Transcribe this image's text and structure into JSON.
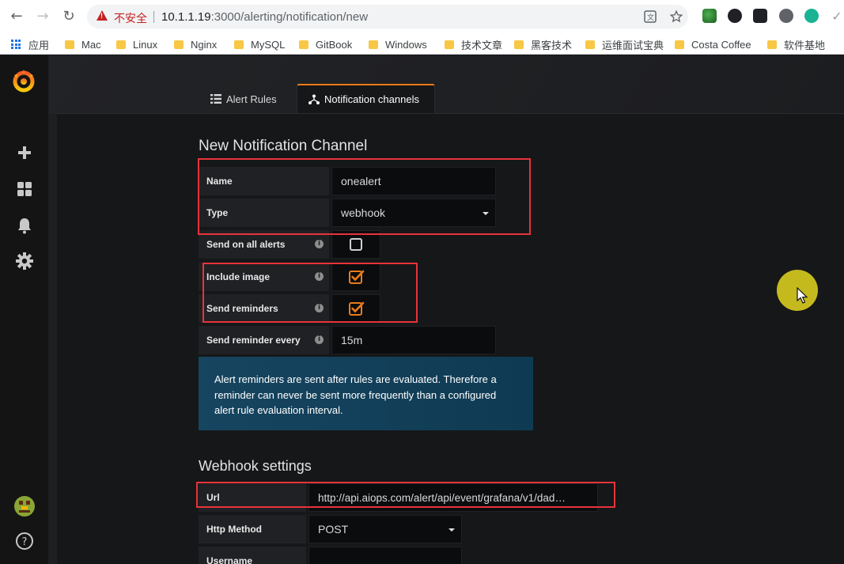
{
  "browser": {
    "security_label": "不安全",
    "url_host": "10.1.1.19",
    "url_path": ":3000/alerting/notification/new",
    "bookmarks": [
      "应用",
      "Mac",
      "Linux",
      "Nginx",
      "MySQL",
      "GitBook",
      "Windows",
      "技术文章",
      "黑客技术",
      "运维面试宝典",
      "Costa Coffee",
      "软件基地"
    ]
  },
  "tabs": {
    "alert_rules": "Alert Rules",
    "notification_channels": "Notification channels"
  },
  "form": {
    "title": "New Notification Channel",
    "name_label": "Name",
    "name_value": "onealert",
    "type_label": "Type",
    "type_value": "webhook",
    "send_all_label": "Send on all alerts",
    "send_all_checked": false,
    "include_image_label": "Include image",
    "include_image_checked": true,
    "send_reminders_label": "Send reminders",
    "send_reminders_checked": true,
    "reminder_every_label": "Send reminder every",
    "reminder_every_value": "15m",
    "info_text": "Alert reminders are sent after rules are evaluated. Therefore a reminder can never be sent more frequently than a configured alert rule evaluation interval."
  },
  "webhook": {
    "title": "Webhook settings",
    "url_label": "Url",
    "url_value": "http://api.aiops.com/alert/api/event/grafana/v1/dad…",
    "method_label": "Http Method",
    "method_value": "POST",
    "username_label": "Username"
  },
  "colors": {
    "accent": "#eb7b18",
    "annotation_red": "#e8333a",
    "info_blue": "#164560",
    "cursor_highlight": "#ded21e"
  }
}
